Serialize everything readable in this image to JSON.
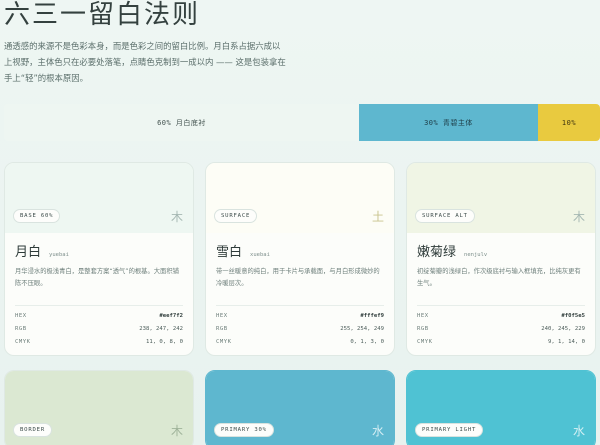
{
  "header": {
    "title": "六三一留白法则",
    "intro": "通透感的来源不是色彩本身，而是色彩之间的留白比例。月白系占据六成以上视野，主体色只在必要处落笔，点睛色克制到一成以内 —— 这是包装拿在手上“轻”的根本原因。"
  },
  "ratio_bar": [
    {
      "label": "60%  月白底衬",
      "fraction": 0.6,
      "color": "#eef6f2"
    },
    {
      "label": "30%  青碧主体",
      "fraction": 0.3,
      "color": "#5eb7cf"
    },
    {
      "label": "10%",
      "fraction": 0.1,
      "color": "#e9ca3f"
    }
  ],
  "spec_labels": {
    "hex": "HEX",
    "rgb": "RGB",
    "cmyk": "CMYK"
  },
  "cards": [
    {
      "tag": "BASE 60%",
      "glyph": "木",
      "name": "月白",
      "pinyin": "yuebai",
      "desc": "月华浸水的极浅青白，是整套方案“透气”的根基。大面积铺陈不压眼。",
      "hex": "#eef7f2",
      "rgb": "238, 247, 242",
      "cmyk": "11, 0, 8, 0",
      "swatch": "#eef7f2"
    },
    {
      "tag": "SURFACE",
      "glyph": "土",
      "name": "雪白",
      "pinyin": "xuebai",
      "desc": "带一丝暖意的纯白，用于卡片与承载面，与月白形成微妙的冷暖层次。",
      "hex": "#fffef9",
      "rgb": "255, 254, 249",
      "cmyk": "0, 1, 3, 0",
      "swatch": "#fdfdf6"
    },
    {
      "tag": "SURFACE ALT",
      "glyph": "木",
      "name": "嫩菊绿",
      "pinyin": "nenjulv",
      "desc": "初绽菊瓣的浅绿白，作次级底衬与输入框填充，比纯灰更有生气。",
      "hex": "#f0f5e5",
      "rgb": "240, 245, 229",
      "cmyk": "9, 1, 14, 0",
      "swatch": "#f0f5e5"
    },
    {
      "tag": "BORDER",
      "glyph": "木",
      "swatch": "#dbe8d2"
    },
    {
      "tag": "PRIMARY 30%",
      "glyph": "水",
      "swatch": "#5eb7cf"
    },
    {
      "tag": "PRIMARY LIGHT",
      "glyph": "水",
      "swatch": "#4fc2d3"
    }
  ]
}
